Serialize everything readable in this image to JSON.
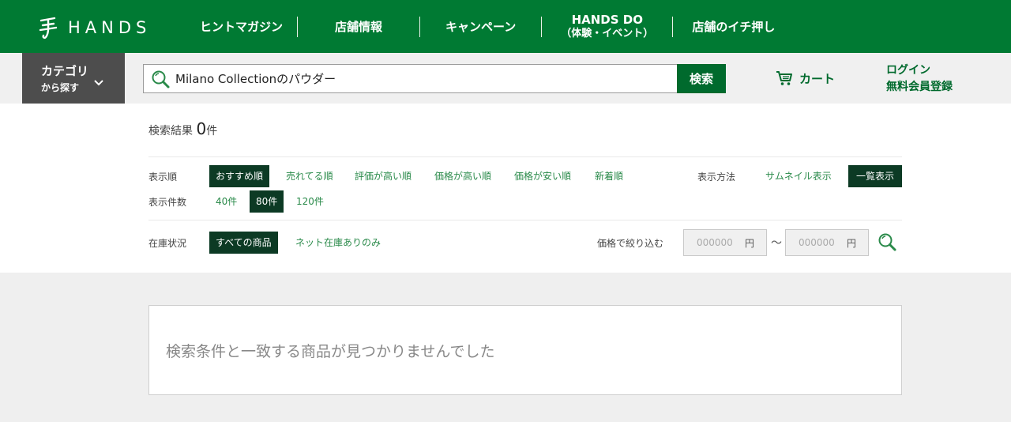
{
  "brand": {
    "name": "HANDS",
    "logo_icon": "hands-kanji-logo"
  },
  "global_nav": [
    {
      "label": "ヒントマガジン"
    },
    {
      "label": "店舗情報"
    },
    {
      "label": "キャンペーン"
    },
    {
      "label": "HANDS DO",
      "sub": "（体験・イベント）"
    },
    {
      "label": "店舗のイチ押し"
    }
  ],
  "category": {
    "line1": "カテゴリ",
    "line2": "から探す",
    "icon": "chevron-down-icon"
  },
  "search": {
    "value": "Milano Collectionのパウダー",
    "button_label": "検索",
    "icon": "search-icon"
  },
  "cart": {
    "label": "カート",
    "icon": "cart-icon"
  },
  "auth": {
    "login": "ログイン",
    "register": "無料会員登録"
  },
  "results": {
    "label": "検索結果",
    "count": "0",
    "unit": "件"
  },
  "sort": {
    "label": "表示順",
    "options": [
      "おすすめ順",
      "売れてる順",
      "評価が高い順",
      "価格が高い順",
      "価格が安い順",
      "新着順"
    ],
    "selected": "おすすめ順"
  },
  "view": {
    "label": "表示方法",
    "options": [
      "サムネイル表示",
      "一覧表示"
    ],
    "selected": "一覧表示"
  },
  "per_page": {
    "label": "表示件数",
    "options": [
      "40件",
      "80件",
      "120件"
    ],
    "selected": "80件"
  },
  "stock": {
    "label": "在庫状況",
    "options": [
      "すべての商品",
      "ネット在庫ありのみ"
    ],
    "selected": "すべての商品"
  },
  "price_filter": {
    "label": "価格で絞り込む",
    "min_placeholder": "000000",
    "max_placeholder": "000000",
    "unit": "円",
    "separator": "～"
  },
  "empty_message": "検索条件と一致する商品が見つかりませんでした",
  "colors": {
    "brand_green": "#007a33",
    "active_dark": "#0c3a24",
    "link_green": "#2a8a4a"
  }
}
